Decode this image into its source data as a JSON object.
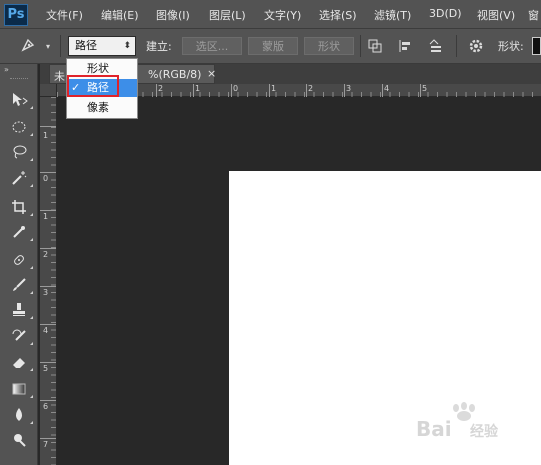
{
  "app": {
    "logo": "Ps"
  },
  "menubar": {
    "items": [
      {
        "label": "文件(F)"
      },
      {
        "label": "编辑(E)"
      },
      {
        "label": "图像(I)"
      },
      {
        "label": "图层(L)"
      },
      {
        "label": "文字(Y)"
      },
      {
        "label": "选择(S)"
      },
      {
        "label": "滤镜(T)"
      },
      {
        "label": "3D(D)"
      },
      {
        "label": "视图(V)"
      },
      {
        "label": "窗"
      }
    ]
  },
  "options": {
    "tool_icon": "pen-icon",
    "mode_value": "路径",
    "build_label": "建立:",
    "selection_button": "选区...",
    "mask_button": "蒙版",
    "shape_button": "形状",
    "shape_label": "形状:"
  },
  "dropdown": {
    "items": [
      {
        "label": "形状"
      },
      {
        "label": "路径",
        "selected": true
      },
      {
        "label": "像素"
      }
    ],
    "check": "✓",
    "highlight_color": "#e0232a"
  },
  "tab": {
    "title_prefix": "未",
    "title_suffix": "%(RGB/8)",
    "close": "×"
  },
  "ruler": {
    "h_labels": [
      "2",
      "1",
      "0",
      "1",
      "2",
      "3",
      "4",
      "5"
    ],
    "v_labels": [
      "1",
      "0",
      "1",
      "2",
      "3",
      "4",
      "5",
      "6",
      "7"
    ]
  },
  "watermark": {
    "text": "Bai 经验"
  },
  "colors": {
    "accent": "#3d8ee8",
    "panel": "#535353",
    "pasteboard": "#282828",
    "canvas": "#ffffff"
  }
}
